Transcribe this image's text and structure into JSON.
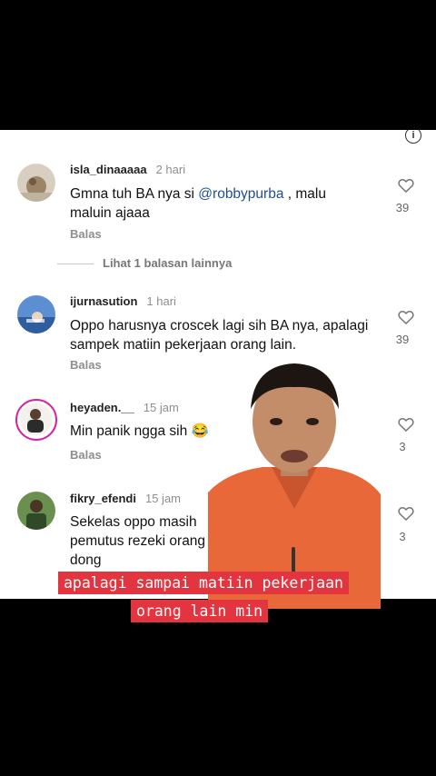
{
  "comments": [
    {
      "user": "isla_dinaaaaa",
      "time": "2 hari",
      "text_before": "Gmna tuh BA nya si ",
      "mention": "@robbypurba",
      "text_after": " , malu maluin ajaaa",
      "reply": "Balas",
      "likes": "39"
    },
    {
      "user": "ijurnasution",
      "time": "1 hari",
      "text": "Oppo harusnya croscek lagi sih BA nya, apalagi sampek matiin pekerjaan orang lain.",
      "reply": "Balas",
      "likes": "39"
    },
    {
      "user": "heyaden.__",
      "time": "15 jam",
      "text": "Min panik ngga sih 😂",
      "reply": "Balas",
      "likes": "3"
    },
    {
      "user": "fikry_efendi",
      "time": "15 jam",
      "text": "Sekelas oppo masih pemutus rezeki orang dong",
      "likes": "3"
    }
  ],
  "more_replies": "Lihat 1 balasan lainnya",
  "caption": {
    "line1": "apalagi sampai matiin pekerjaan",
    "line2": "orang lain min"
  },
  "icons": {
    "info": "info-icon",
    "heart": "heart-icon"
  },
  "colors": {
    "caption_bg": "#e3353f",
    "mention": "#1f4e96"
  }
}
